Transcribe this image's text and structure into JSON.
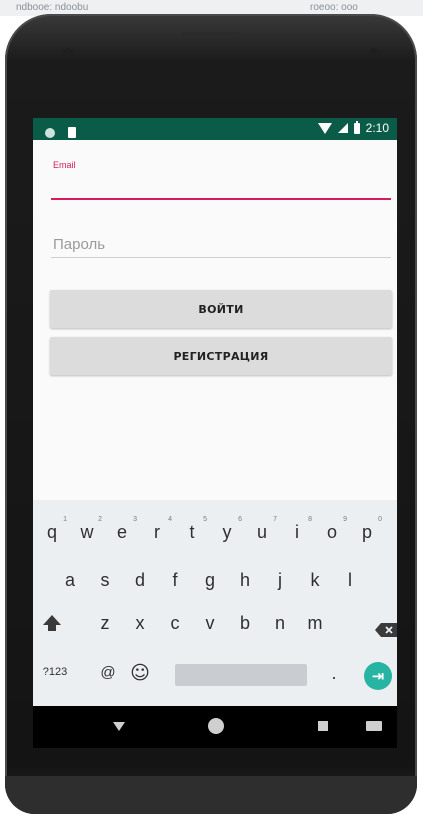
{
  "top_strip": {
    "left_text": "ndbooe: ndoobu",
    "right_text": "roeoo: ooo"
  },
  "status_bar": {
    "time": "2:10"
  },
  "form": {
    "email_label": "Email",
    "email_value": "",
    "password_placeholder": "Пароль",
    "login_button": "ВОЙТИ",
    "register_button": "РЕГИСТРАЦИЯ"
  },
  "keyboard": {
    "row1": [
      "q",
      "w",
      "e",
      "r",
      "t",
      "y",
      "u",
      "i",
      "o",
      "p"
    ],
    "row1_hints": [
      "1",
      "2",
      "3",
      "4",
      "5",
      "6",
      "7",
      "8",
      "9",
      "0"
    ],
    "row2": [
      "a",
      "s",
      "d",
      "f",
      "g",
      "h",
      "j",
      "k",
      "l"
    ],
    "row3": [
      "z",
      "x",
      "c",
      "v",
      "b",
      "n",
      "m"
    ],
    "symbols_key": "?123",
    "at_key": "@",
    "emoji_key": "☺",
    "period_key": ".",
    "enter_key": "⇥"
  },
  "colors": {
    "status_bar": "#0a5c48",
    "accent": "#d81b60",
    "enter_key": "#27b4a2"
  }
}
